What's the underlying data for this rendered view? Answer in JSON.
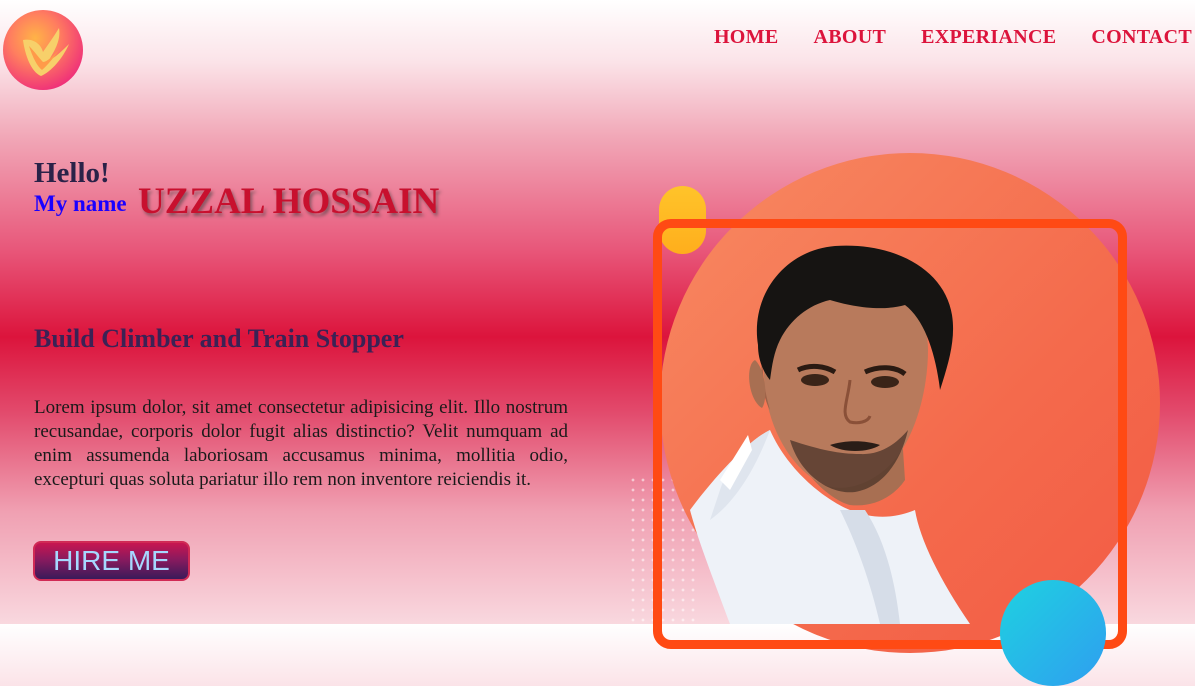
{
  "header": {
    "logo_icon": "flame-v-logo-icon",
    "nav": [
      {
        "label": "HOME"
      },
      {
        "label": "ABOUT"
      },
      {
        "label": "EXPERIANCE"
      },
      {
        "label": "CONTACT"
      }
    ]
  },
  "hero": {
    "greeting": "Hello!",
    "my_name_label": "My name",
    "full_name": "UZZAL HOSSAIN",
    "tagline": "Build Climber and Train Stopper",
    "bio": "Lorem ipsum dolor, sit amet consectetur adipisicing elit. Illo nostrum recusandae, corporis dolor fugit alias distinctio? Velit numquam ad enim assumenda laboriosam accusamus minima, mollitia odio, excepturi quas soluta pariatur illo rem non inventore reiciendis it.",
    "hire_button": "HIRE ME"
  },
  "colors": {
    "accent": "#dc143c",
    "name_blue": "#1a00ff",
    "frame_orange": "#ff4a14",
    "circle_coral": "#f46a4c",
    "button_text": "#a6d8ff"
  }
}
